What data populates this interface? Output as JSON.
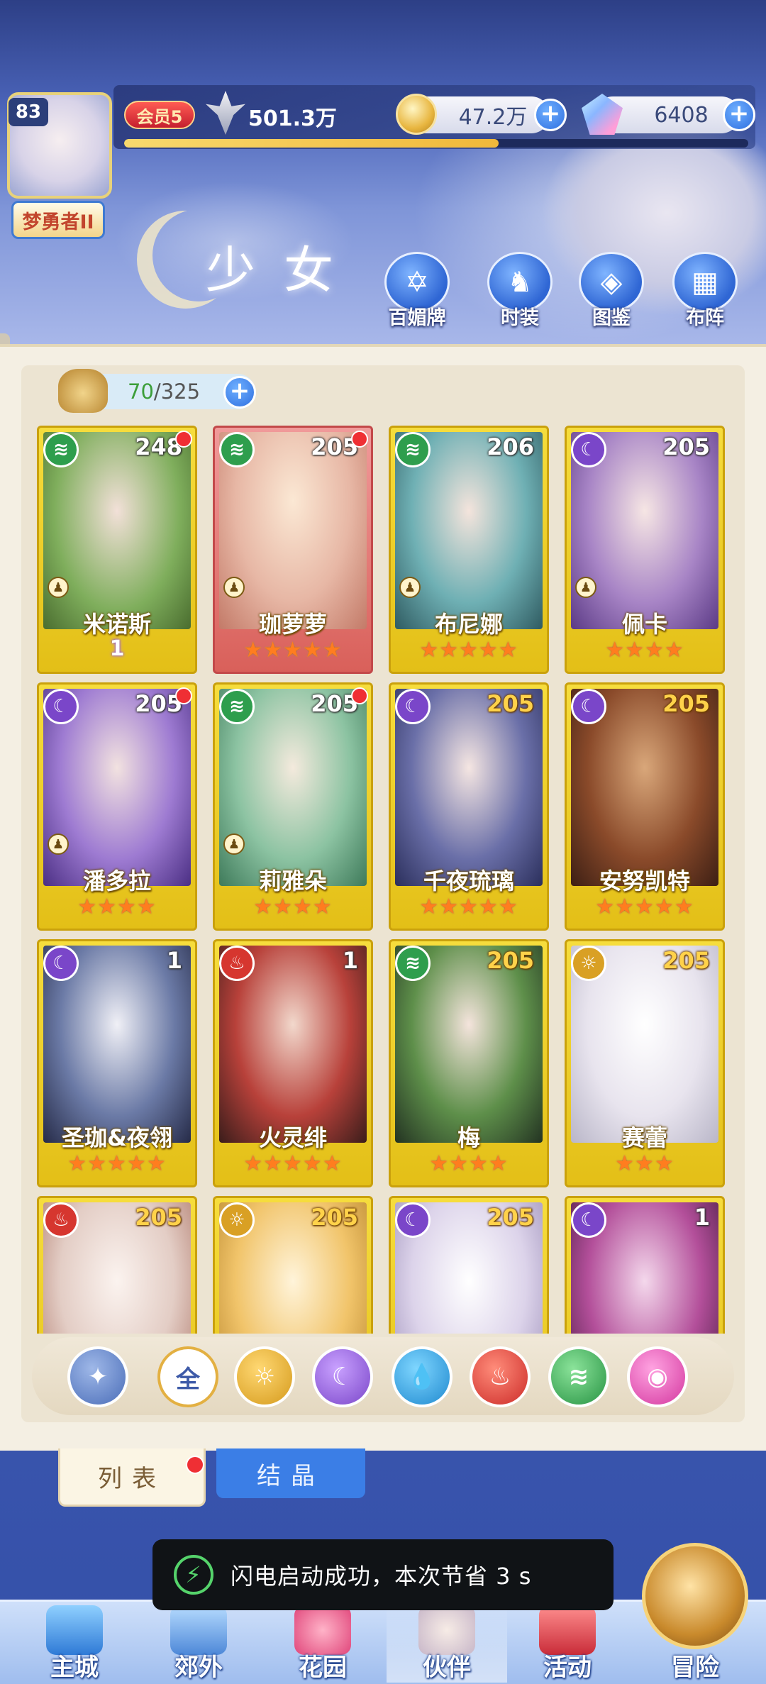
{
  "player": {
    "level": "83",
    "title": "梦勇者II",
    "vip": "会员5",
    "power": "501.3万",
    "exp_progress": 0.6
  },
  "resources": {
    "gold": "47.2万",
    "gems": "6408"
  },
  "page": {
    "title": "少女"
  },
  "menu": [
    {
      "label": "百媚牌",
      "icon": "card-deck-icon"
    },
    {
      "label": "时装",
      "icon": "outfit-icon"
    },
    {
      "label": "图鉴",
      "icon": "codex-book-icon"
    },
    {
      "label": "布阵",
      "icon": "formation-grid-icon"
    }
  ],
  "roster": {
    "current": "70",
    "max": "325"
  },
  "cards": [
    {
      "name": "米诺斯",
      "level": "248",
      "element": "wind",
      "stars": 0,
      "awaken": "1",
      "red_dot": true
    },
    {
      "name": "珈萝萝",
      "level": "205",
      "element": "wind",
      "stars": 5,
      "red_dot": true
    },
    {
      "name": "布尼娜",
      "level": "206",
      "element": "wind",
      "stars": 5,
      "red_dot": false
    },
    {
      "name": "佩卡",
      "level": "205",
      "element": "dark",
      "stars": 4,
      "red_dot": false
    },
    {
      "name": "潘多拉",
      "level": "205",
      "element": "dark",
      "stars": 4,
      "red_dot": true
    },
    {
      "name": "莉雅朵",
      "level": "205",
      "element": "wind",
      "stars": 4,
      "red_dot": true
    },
    {
      "name": "千夜琉璃",
      "level": "205",
      "element": "dark",
      "stars": 5,
      "red_dot": false
    },
    {
      "name": "安努凯特",
      "level": "205",
      "element": "dark",
      "stars": 5,
      "red_dot": false
    },
    {
      "name": "圣珈&夜翎",
      "level": "1",
      "element": "dark",
      "stars": 5,
      "red_dot": false
    },
    {
      "name": "火灵绯",
      "level": "1",
      "element": "fire",
      "stars": 5,
      "red_dot": false
    },
    {
      "name": "梅",
      "level": "205",
      "element": "wind",
      "stars": 4,
      "red_dot": false
    },
    {
      "name": "赛蕾",
      "level": "205",
      "element": "light",
      "stars": 3,
      "red_dot": false
    },
    {
      "name": "",
      "level": "205",
      "element": "fire",
      "stars": 0,
      "red_dot": false
    },
    {
      "name": "",
      "level": "205",
      "element": "light",
      "stars": 0,
      "red_dot": false
    },
    {
      "name": "",
      "level": "205",
      "element": "dark",
      "stars": 0,
      "red_dot": false
    },
    {
      "name": "",
      "level": "1",
      "element": "dark",
      "stars": 0,
      "red_dot": false
    }
  ],
  "filters": {
    "all_label": "全"
  },
  "tabs": {
    "list": "列表",
    "crystal": "结晶"
  },
  "toast": {
    "message": "闪电启动成功，本次节省 3 s"
  },
  "nav": [
    {
      "label": "主城",
      "icon": "castle-icon"
    },
    {
      "label": "郊外",
      "icon": "outskirts-icon"
    },
    {
      "label": "花园",
      "icon": "garden-icon"
    },
    {
      "label": "伙伴",
      "icon": "partner-icon"
    },
    {
      "label": "活动",
      "icon": "event-gift-icon"
    },
    {
      "label": "冒险",
      "icon": "adventure-compass-icon"
    }
  ],
  "colors": {
    "card_gold": "#e3bf17",
    "card_red": "#d9605a",
    "wind": "#2e9e4d",
    "dark": "#7a46c9",
    "fire": "#d6362f",
    "light": "#d9a024",
    "accent_blue": "#3b7ee6"
  }
}
